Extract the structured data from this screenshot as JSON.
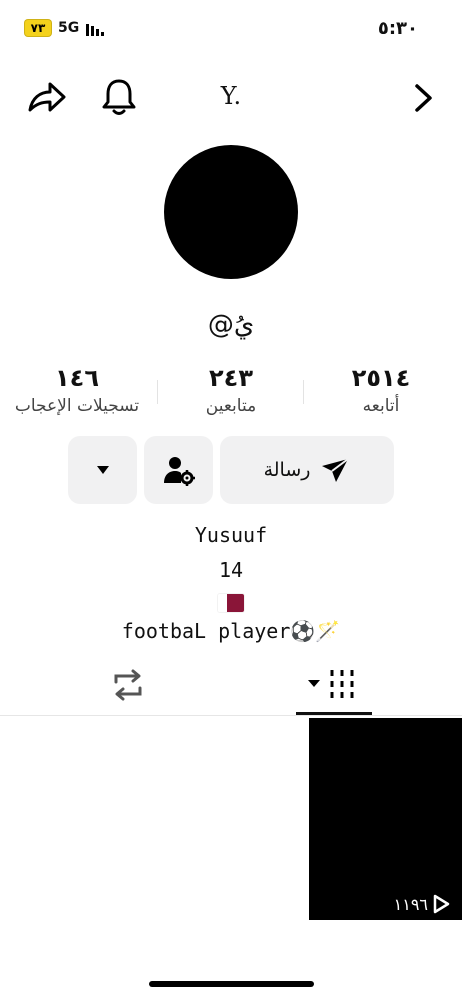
{
  "status_bar": {
    "battery": "٧٣",
    "network": "5G",
    "time": "٥:٣٠"
  },
  "nav": {
    "title": "Y.",
    "icons": [
      "share-icon",
      "bell-icon",
      "chevron-right-icon"
    ]
  },
  "profile": {
    "username": "@يُ",
    "stats": [
      {
        "value": "١٤٦",
        "label": "تسجيلات الإعجاب"
      },
      {
        "value": "٢٤٣",
        "label": "متابعين"
      },
      {
        "value": "٢٥١٤",
        "label": "أتابعه"
      }
    ],
    "buttons": {
      "message_label": "رسالة",
      "follow_settings_icon": "user-settings-icon",
      "more_icon": "caret-down-icon"
    },
    "bio": {
      "line1": "Yusuuf",
      "line2": "14",
      "line3": "footbaL player⚽🪄"
    }
  },
  "tabs": [
    {
      "name": "reposts",
      "icon": "repost-icon"
    },
    {
      "name": "videos",
      "icon": "grid-icon",
      "active": true
    }
  ],
  "videos": [
    {
      "views": "١١٩٦"
    }
  ],
  "colors": {
    "battery_bg": "#f4d21c",
    "button_bg": "#f1f1f2",
    "flag_maroon": "#8a1538"
  }
}
